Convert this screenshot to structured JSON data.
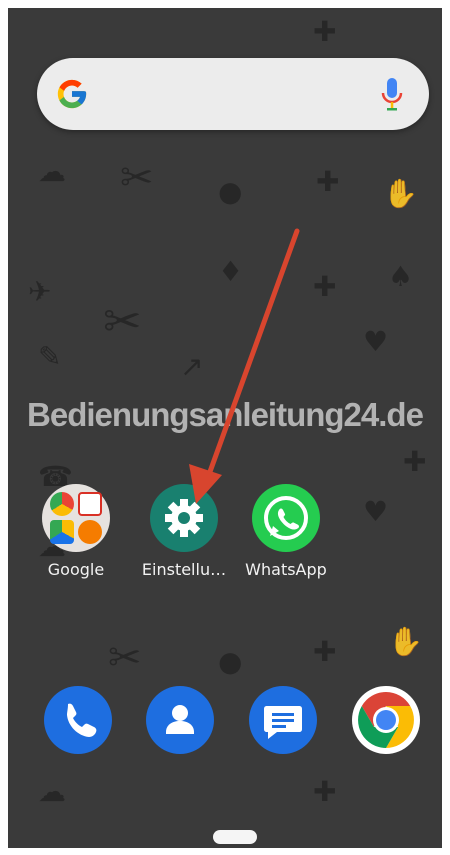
{
  "search_bar": {
    "google_icon": "google-g-icon",
    "mic_icon": "microphone-icon"
  },
  "watermark": "Bedienungsanleitung24.de",
  "home_apps": [
    {
      "label": "Google",
      "icon": "google-folder-icon"
    },
    {
      "label": "Einstellu…",
      "icon": "settings-gear-icon"
    },
    {
      "label": "WhatsApp",
      "icon": "whatsapp-icon"
    }
  ],
  "dock": [
    {
      "icon": "phone-icon"
    },
    {
      "icon": "contacts-icon"
    },
    {
      "icon": "messages-icon"
    },
    {
      "icon": "chrome-icon"
    }
  ],
  "annotation": {
    "arrow_color": "#d8452e"
  },
  "colors": {
    "settings": "#19806f",
    "whatsapp": "#25cc50",
    "dock_blue": "#1e6ee0"
  }
}
